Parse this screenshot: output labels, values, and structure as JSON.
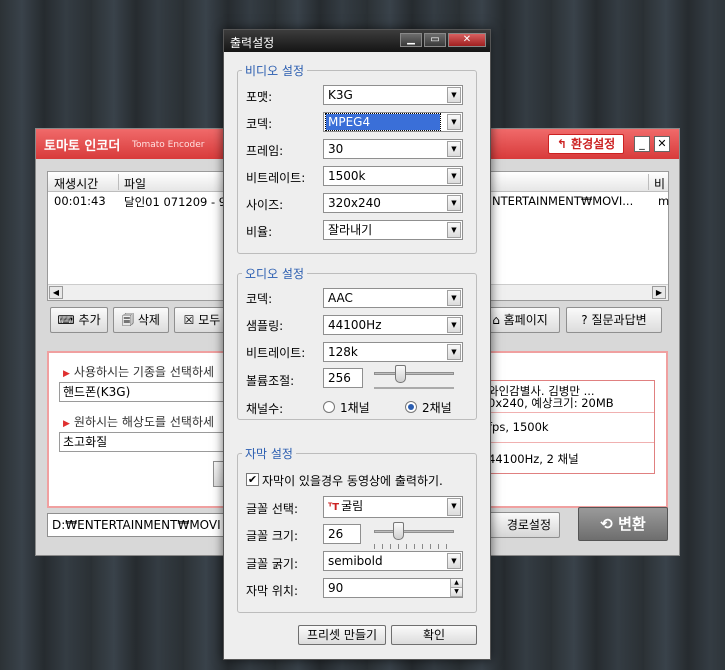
{
  "main_window": {
    "title": "토마토 인코더",
    "subtitle": "Tomato Encoder",
    "env_button": "↰ 환경설정",
    "minimize": "_",
    "close": "✕",
    "list": {
      "headers": [
        "재생시간",
        "파일",
        "비"
      ],
      "row": {
        "duration": "00:01:43",
        "file": "달인01 071209 - 9",
        "path": "NTERTAINMENT₩MOVI...",
        "extra": "m"
      }
    },
    "toolbar": {
      "add": "⌨ 추가",
      "delete": "🗐 삭제",
      "remove_all": "☒ 모두",
      "homepage": "⌂ 홈페이지",
      "faq": "? 질문과답변"
    },
    "device_label": "사용하시는 기종을 선택하세",
    "device_value": "핸드폰(K3G)",
    "quality_label": "원하시는 해상도를 선택하세",
    "quality_value": "초고화질",
    "info": {
      "line1": "와인감별사. 김병만 ...",
      "line2": "0x240, 예상크기: 20MB",
      "line3": "fps, 1500k",
      "line4": "44100Hz, 2 채널"
    },
    "output_path": "D:₩ENTERTAINMENT₩MOVI",
    "route_button": "경로설정",
    "convert_button": "⟲ 변환"
  },
  "dialog": {
    "title": "출력설정",
    "video": {
      "legend": "비디오 설정",
      "format_label": "포맷:",
      "format_value": "K3G",
      "codec_label": "코덱:",
      "codec_value": "MPEG4",
      "frame_label": "프레임:",
      "frame_value": "30",
      "bitrate_label": "비트레이트:",
      "bitrate_value": "1500k",
      "size_label": "사이즈:",
      "size_value": "320x240",
      "ratio_label": "비율:",
      "ratio_value": "잘라내기"
    },
    "audio": {
      "legend": "오디오 설정",
      "codec_label": "코덱:",
      "codec_value": "AAC",
      "sampling_label": "샘플링:",
      "sampling_value": "44100Hz",
      "bitrate_label": "비트레이트:",
      "bitrate_value": "128k",
      "volume_label": "볼륨조절:",
      "volume_value": "256",
      "volume_level": 0.3,
      "channels_label": "채널수:",
      "mono_label": "1채널",
      "stereo_label": "2채널",
      "selected_channel": "2채널"
    },
    "subtitle": {
      "legend": "자막 설정",
      "checkbox_label": "자막이 있을경우 동영상에 출력하기.",
      "checked": true,
      "font_label": "글꼴 선택:",
      "font_value": "굴림",
      "size_label": "글꼴 크기:",
      "size_value": "26",
      "size_level": 0.28,
      "weight_label": "글꼴 굵기:",
      "weight_value": "semibold",
      "position_label": "자막 위치:",
      "position_value": "90"
    },
    "preset_button": "프리셋 만들기",
    "ok_button": "확인"
  },
  "colors": {
    "main_title_bar": "#e24a4a",
    "dialog_title_bar": "#1e1e1e",
    "group_legend": "#2a5db0",
    "selection": "#3a6fd8"
  }
}
